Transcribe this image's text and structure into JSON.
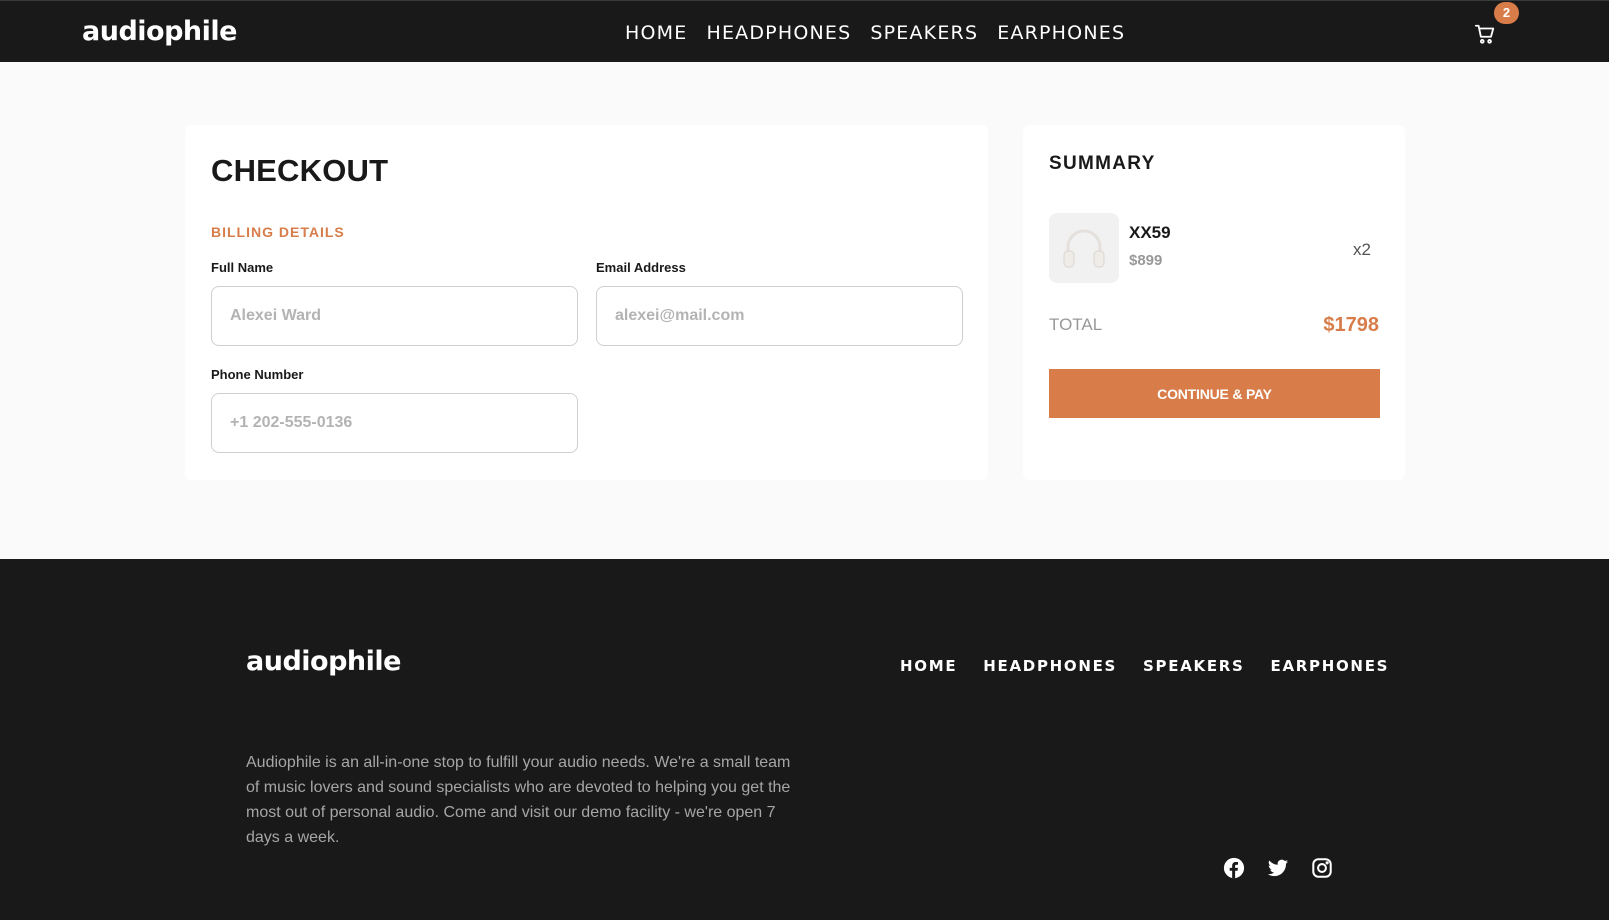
{
  "header": {
    "logo": "audiophile",
    "nav": [
      "HOME",
      "HEADPHONES",
      "SPEAKERS",
      "EARPHONES"
    ],
    "cart_count": "2",
    "cart_icon": "cart-icon"
  },
  "checkout": {
    "title": "CHECKOUT",
    "section_label": "BILLING DETAILS",
    "full_name": {
      "label": "Full Name",
      "placeholder": "Alexei Ward",
      "value": ""
    },
    "email": {
      "label": "Email Address",
      "placeholder": "alexei@mail.com",
      "value": ""
    },
    "phone": {
      "label": "Phone Number",
      "placeholder": "+1 202-555-0136",
      "value": ""
    }
  },
  "summary": {
    "title": "SUMMARY",
    "item": {
      "name": "XX59",
      "price": "$899",
      "quantity": "x2",
      "image_icon": "headphones-icon"
    },
    "total_label": "TOTAL",
    "total_value": "$1798",
    "pay_button": "CONTINUE & PAY"
  },
  "footer": {
    "logo": "audiophile",
    "nav": [
      "HOME",
      "HEADPHONES",
      "SPEAKERS",
      "EARPHONES"
    ],
    "description": "Audiophile is an all-in-one stop to fulfill your audio needs. We're a small team of music lovers and sound specialists who are devoted to helping you get the most out of personal audio. Come and visit our demo facility - we're open 7 days a week.",
    "socials": [
      "facebook-icon",
      "twitter-icon",
      "instagram-icon"
    ]
  },
  "colors": {
    "accent": "#d87d4a",
    "dark": "#191919",
    "background": "#fafafa"
  }
}
